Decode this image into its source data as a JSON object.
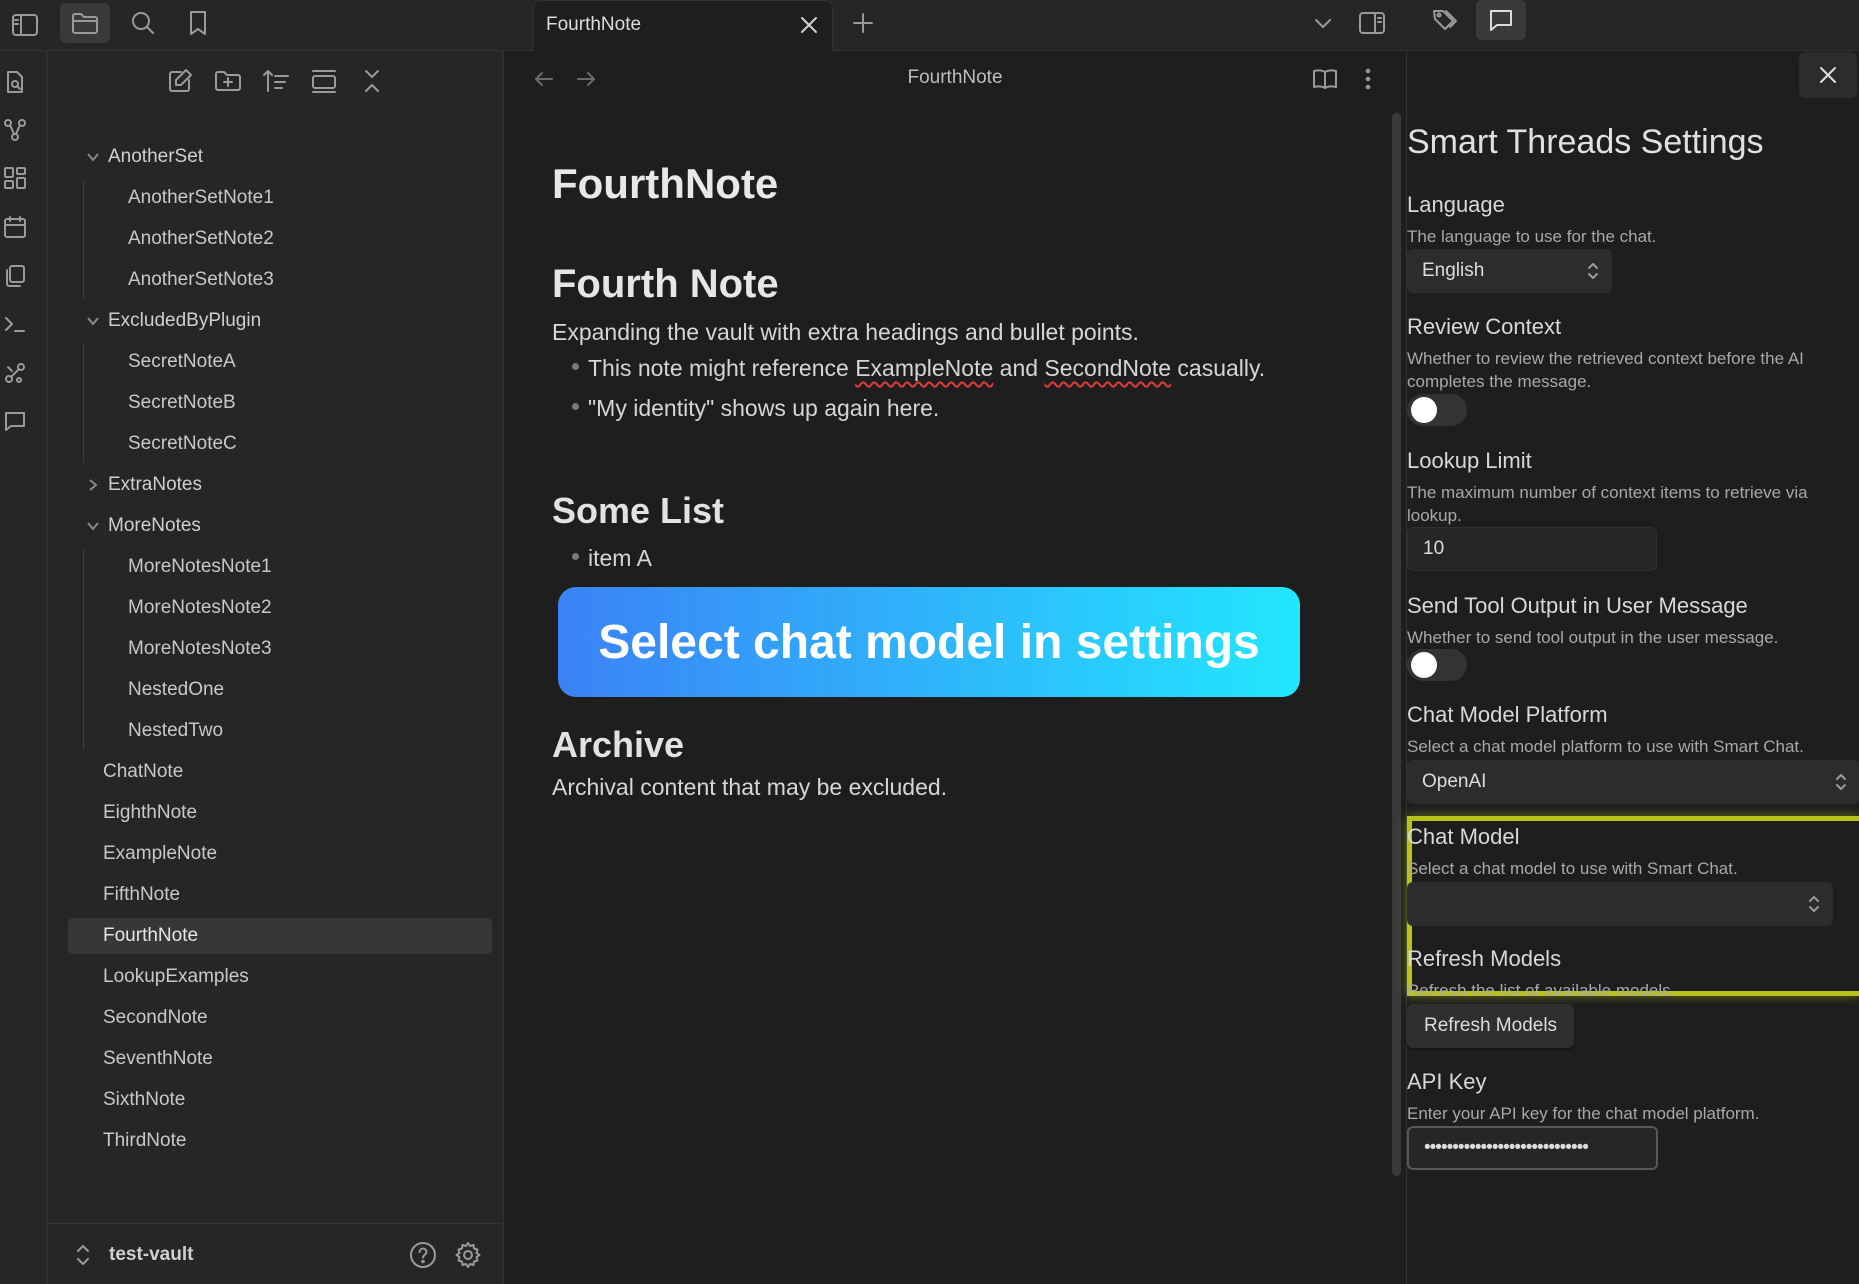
{
  "topbar": {
    "icons": [
      "sidebar-toggle-icon",
      "folder-icon",
      "search-icon",
      "bookmark-icon",
      "plus-icon",
      "chevron-down-icon",
      "right-sidebar-icon",
      "tags-icon",
      "chat-icon"
    ],
    "active_tab": "FourthNote"
  },
  "ribbon": {
    "icons": [
      "open-quick-switcher-icon",
      "graph-view-icon",
      "canvas-icon",
      "daily-note-icon",
      "templates-icon",
      "command-palette-icon",
      "smart-connections-icon",
      "smart-chat-icon"
    ]
  },
  "explorer": {
    "toolbar": [
      "new-note-icon",
      "new-folder-icon",
      "sort-icon",
      "collapse-all-icon",
      "close-icon"
    ],
    "tree": [
      {
        "label": "AnotherSet",
        "type": "folder",
        "expanded": true
      },
      {
        "label": "AnotherSetNote1",
        "type": "file",
        "indent": 1
      },
      {
        "label": "AnotherSetNote2",
        "type": "file",
        "indent": 1
      },
      {
        "label": "AnotherSetNote3",
        "type": "file",
        "indent": 1
      },
      {
        "label": "ExcludedByPlugin",
        "type": "folder",
        "expanded": true
      },
      {
        "label": "SecretNoteA",
        "type": "file",
        "indent": 1
      },
      {
        "label": "SecretNoteB",
        "type": "file",
        "indent": 1
      },
      {
        "label": "SecretNoteC",
        "type": "file",
        "indent": 1
      },
      {
        "label": "ExtraNotes",
        "type": "folder",
        "expanded": false
      },
      {
        "label": "MoreNotes",
        "type": "folder",
        "expanded": true
      },
      {
        "label": "MoreNotesNote1",
        "type": "file",
        "indent": 1
      },
      {
        "label": "MoreNotesNote2",
        "type": "file",
        "indent": 1
      },
      {
        "label": "MoreNotesNote3",
        "type": "file",
        "indent": 1
      },
      {
        "label": "NestedOne",
        "type": "file",
        "indent": 1
      },
      {
        "label": "NestedTwo",
        "type": "file",
        "indent": 1
      },
      {
        "label": "ChatNote",
        "type": "file",
        "indent": 0
      },
      {
        "label": "EighthNote",
        "type": "file",
        "indent": 0
      },
      {
        "label": "ExampleNote",
        "type": "file",
        "indent": 0
      },
      {
        "label": "FifthNote",
        "type": "file",
        "indent": 0
      },
      {
        "label": "FourthNote",
        "type": "file",
        "indent": 0,
        "active": true
      },
      {
        "label": "LookupExamples",
        "type": "file",
        "indent": 0
      },
      {
        "label": "SecondNote",
        "type": "file",
        "indent": 0
      },
      {
        "label": "SeventhNote",
        "type": "file",
        "indent": 0
      },
      {
        "label": "SixthNote",
        "type": "file",
        "indent": 0
      },
      {
        "label": "ThirdNote",
        "type": "file",
        "indent": 0
      }
    ],
    "vault_name": "test-vault"
  },
  "editor": {
    "view_title": "FourthNote",
    "doc_title": "FourthNote",
    "heading1": "Fourth Note",
    "para1": "Expanding the vault with extra headings and bullet points.",
    "bullet1": {
      "pre": "This note might reference ",
      "link1": "ExampleNote",
      "mid": " and ",
      "link2": "SecondNote",
      "post": " casually."
    },
    "bullet2": "\"My identity\" shows up again here.",
    "heading2": "Some List",
    "bullet3": "item A",
    "cta": "Select chat model in settings",
    "heading3": "Archive",
    "para2": "Archival content that may be excluded."
  },
  "settings": {
    "title": "Smart Threads Settings",
    "language": {
      "label": "Language",
      "desc": "The language to use for the chat.",
      "value": "English"
    },
    "review_context": {
      "label": "Review Context",
      "desc": "Whether to review the retrieved context before the AI completes the message.",
      "enabled": false
    },
    "lookup_limit": {
      "label": "Lookup Limit",
      "desc": "The maximum number of context items to retrieve via lookup.",
      "value": "10"
    },
    "send_tool_output": {
      "label": "Send Tool Output in User Message",
      "desc": "Whether to send tool output in the user message.",
      "enabled": false
    },
    "platform": {
      "label": "Chat Model Platform",
      "desc": "Select a chat model platform to use with Smart Chat.",
      "value": "OpenAI"
    },
    "chat_model": {
      "label": "Chat Model",
      "desc": "Select a chat model to use with Smart Chat.",
      "value": ""
    },
    "refresh": {
      "label": "Refresh Models",
      "desc": "Refresh the list of available models.",
      "button": "Refresh Models"
    },
    "api_key": {
      "label": "API Key",
      "desc": "Enter your API key for the chat model platform.",
      "value": "•••••••••••••••••••••••••••••"
    },
    "highlight_color": "#b8c218"
  }
}
